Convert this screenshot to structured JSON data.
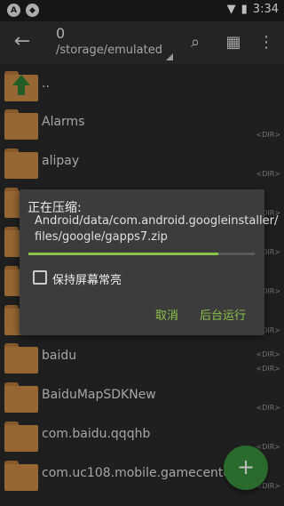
{
  "status_bar": {
    "time": "3:34"
  },
  "toolbar": {
    "count": "0",
    "path": "/storage/emulated"
  },
  "files": [
    {
      "name": "..",
      "dir": ""
    },
    {
      "name": "Alarms",
      "dir": "<DIR>"
    },
    {
      "name": "alipay",
      "dir": "<DIR>"
    },
    {
      "name": "",
      "dir": "<DIR>"
    },
    {
      "name": "",
      "dir": "<DIR>"
    },
    {
      "name": "",
      "dir": "<DIR>"
    },
    {
      "name": "",
      "dir": "<DIR>"
    },
    {
      "name": "",
      "dir": "<DIR>"
    },
    {
      "name": "baidu",
      "dir": "<DIR>"
    },
    {
      "name": "BaiduMapSDKNew",
      "dir": "<DIR>"
    },
    {
      "name": "com.baidu.qqqhb",
      "dir": "<DIR>"
    },
    {
      "name": "com.uc108.mobile.gamecenter",
      "dir": "<DIR>"
    }
  ],
  "dialog": {
    "title": "正在压缩:",
    "file_line1": "Android/data/com.android.googleinstaller/",
    "file_line2": "files/google/gapps7.zip",
    "progress": 0.84,
    "keep_screen_label": "保持屏幕常亮",
    "cancel_label": "取消",
    "background_label": "后台运行"
  },
  "colors": {
    "accent": "#8bc34a",
    "folder": "#c98a44",
    "fab": "#388e3c"
  }
}
